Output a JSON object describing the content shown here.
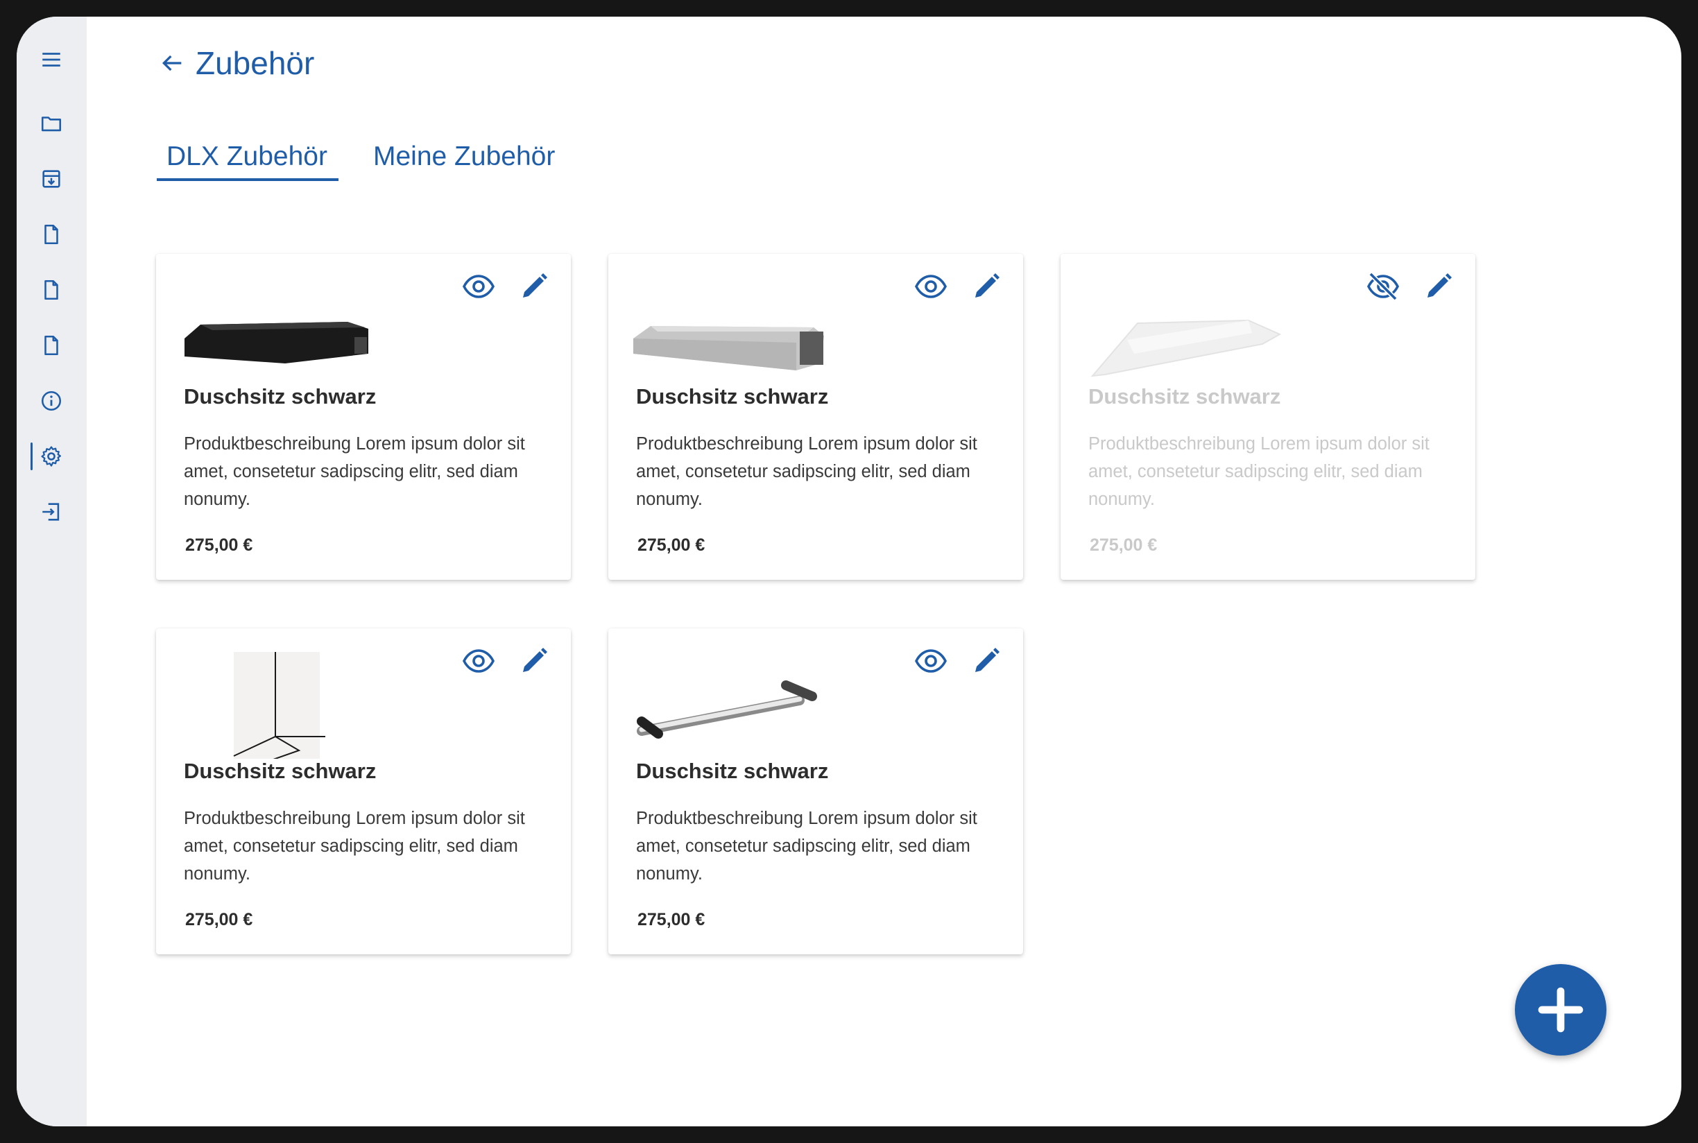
{
  "header": {
    "title": "Zubehör"
  },
  "tabs": [
    {
      "label": "DLX Zubehör",
      "active": true
    },
    {
      "label": "Meine Zubehör",
      "active": false
    }
  ],
  "sidebar": {
    "icons": [
      "menu-icon",
      "folder-icon",
      "archive-download-icon",
      "document-icon",
      "document-icon",
      "document-icon",
      "info-icon",
      "gear-icon",
      "logout-icon"
    ],
    "active": "gear-icon"
  },
  "cards": [
    {
      "name": "Duschsitz schwarz",
      "description": "Produktbeschreibung Lorem ipsum dolor sit amet, consetetur sadipscing elitr, sed diam nonumy.",
      "price": "275,00 €",
      "visible": true,
      "image": "black-shower-seat"
    },
    {
      "name": "Duschsitz schwarz",
      "description": "Produktbeschreibung Lorem ipsum dolor sit amet, consetetur sadipscing elitr, sed diam nonumy.",
      "price": "275,00 €",
      "visible": true,
      "image": "grey-shower-seat"
    },
    {
      "name": "Duschsitz schwarz",
      "description": "Produktbeschreibung Lorem ipsum dolor sit amet, consetetur sadipscing elitr, sed diam nonumy.",
      "price": "275,00 €",
      "visible": false,
      "image": "corner-shelf"
    },
    {
      "name": "Duschsitz schwarz",
      "description": "Produktbeschreibung Lorem ipsum dolor sit amet, consetetur sadipscing elitr, sed diam nonumy.",
      "price": "275,00 €",
      "visible": true,
      "image": "corner-sketch"
    },
    {
      "name": "Duschsitz schwarz",
      "description": "Produktbeschreibung Lorem ipsum dolor sit amet, consetetur sadipscing elitr, sed diam nonumy.",
      "price": "275,00 €",
      "visible": true,
      "image": "grab-bar"
    }
  ],
  "fab": {
    "icon": "plus-icon"
  },
  "colors": {
    "accent": "#1f5da8",
    "sidebar_bg": "#eceef1",
    "text": "#2d2d2d",
    "disabled_text": "#c9c9c9"
  }
}
